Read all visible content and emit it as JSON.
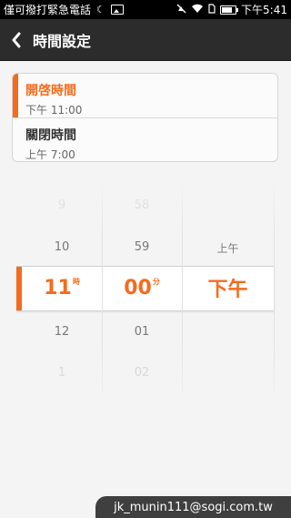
{
  "status_bar": {
    "carrier_text": "僅可撥打緊急電話",
    "time": "下午5:41",
    "icons": [
      "moon-icon",
      "image-icon",
      "mute-icon",
      "wifi-icon",
      "sim-icon",
      "battery-icon"
    ],
    "battery_level": 0.8
  },
  "header": {
    "title": "時間設定",
    "back_icon": "chevron-left-icon"
  },
  "options": [
    {
      "label": "開啓時間",
      "time": "下午 11:00",
      "selected": true
    },
    {
      "label": "關閉時間",
      "time": "上午 7:00",
      "selected": false
    }
  ],
  "picker": {
    "hours": {
      "above2": "9",
      "above1": "10",
      "selected": "11",
      "unit": "時",
      "below1": "12",
      "below2": "1"
    },
    "minutes": {
      "above2": "58",
      "above1": "59",
      "selected": "00",
      "unit": "分",
      "below1": "01",
      "below2": "02"
    },
    "ampm": {
      "above1": "上午",
      "selected": "下午"
    }
  },
  "watermark": "jk_munin111@sogi.com.tw",
  "colors": {
    "accent": "#f56b1d",
    "header_bg": "#2c2c2c",
    "status_bg": "#000000"
  }
}
